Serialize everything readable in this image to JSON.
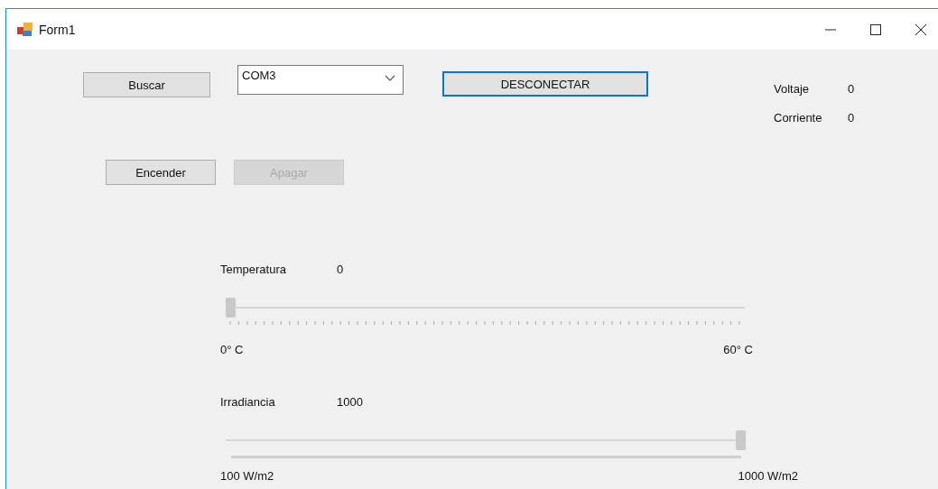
{
  "window": {
    "title": "Form1"
  },
  "buttons": [
    {
      "label": "Buscar",
      "disabled": false,
      "focused": false
    },
    {
      "label": "DESCONECTAR",
      "disabled": false,
      "focused": true
    },
    {
      "label": "Encender",
      "disabled": false,
      "focused": false
    },
    {
      "label": "Apagar",
      "disabled": true,
      "focused": false
    }
  ],
  "port_combo": {
    "value": "COM3"
  },
  "readings": [
    {
      "label": "Voltaje",
      "value": "0"
    },
    {
      "label": "Corriente",
      "value": "0"
    }
  ],
  "sliders": [
    {
      "label": "Temperatura",
      "value": "0",
      "kind": "ticks",
      "level": 0,
      "min_label": "0° C",
      "max_label": "60° C"
    },
    {
      "label": "Irradiancia",
      "value": "1000",
      "kind": "line",
      "level": 1,
      "min_label": "100 W/m2",
      "max_label": "1000 W/m2"
    }
  ]
}
